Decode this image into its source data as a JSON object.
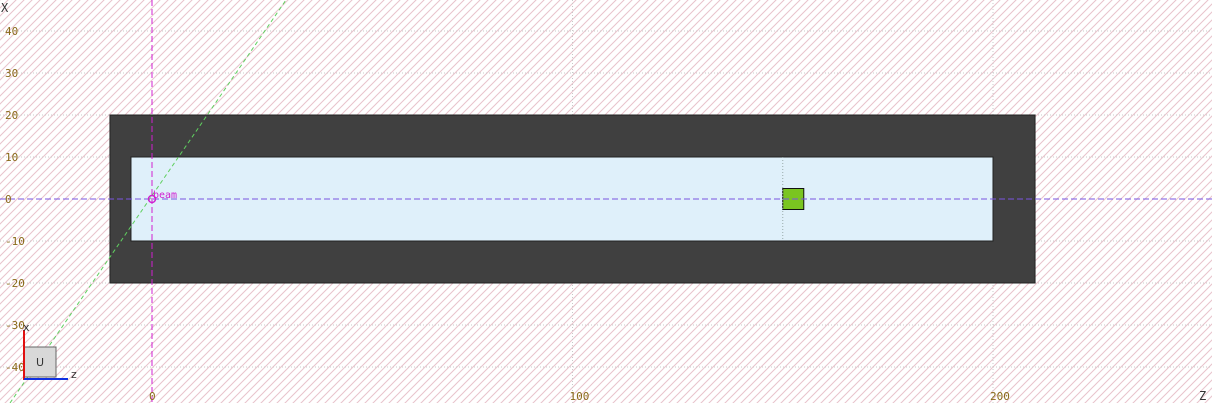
{
  "view": {
    "horizontal_axis": "z",
    "vertical_axis": "x",
    "z_ticks": [
      0,
      100,
      200
    ],
    "x_ticks": [
      40,
      30,
      20,
      10,
      0,
      -10,
      -20,
      -30,
      -40
    ],
    "z_axis_label": "Z",
    "x_axis_label": "X"
  },
  "geometry": {
    "outer_block": {
      "z_min": -10,
      "z_max": 210,
      "x_min": -20,
      "x_max": 20,
      "color": "#404040"
    },
    "inner_void": {
      "z_min": -5,
      "z_max": 200,
      "x_min": -10,
      "x_max": 10,
      "color": "#dff0fa"
    },
    "marker": {
      "z_center": 152.5,
      "x_center": 0,
      "size": 5,
      "color": "#7ac520"
    }
  },
  "beam": {
    "label": "beam",
    "z": 0,
    "x": 0,
    "color": "#d020d0",
    "line_color": "#7a55e0",
    "diagonal_color": "#60d060"
  },
  "orientation_cube": {
    "face_label": "U",
    "x_axis": "x",
    "z_axis": "z",
    "x_color": "#e01010",
    "z_color": "#1030e0"
  }
}
